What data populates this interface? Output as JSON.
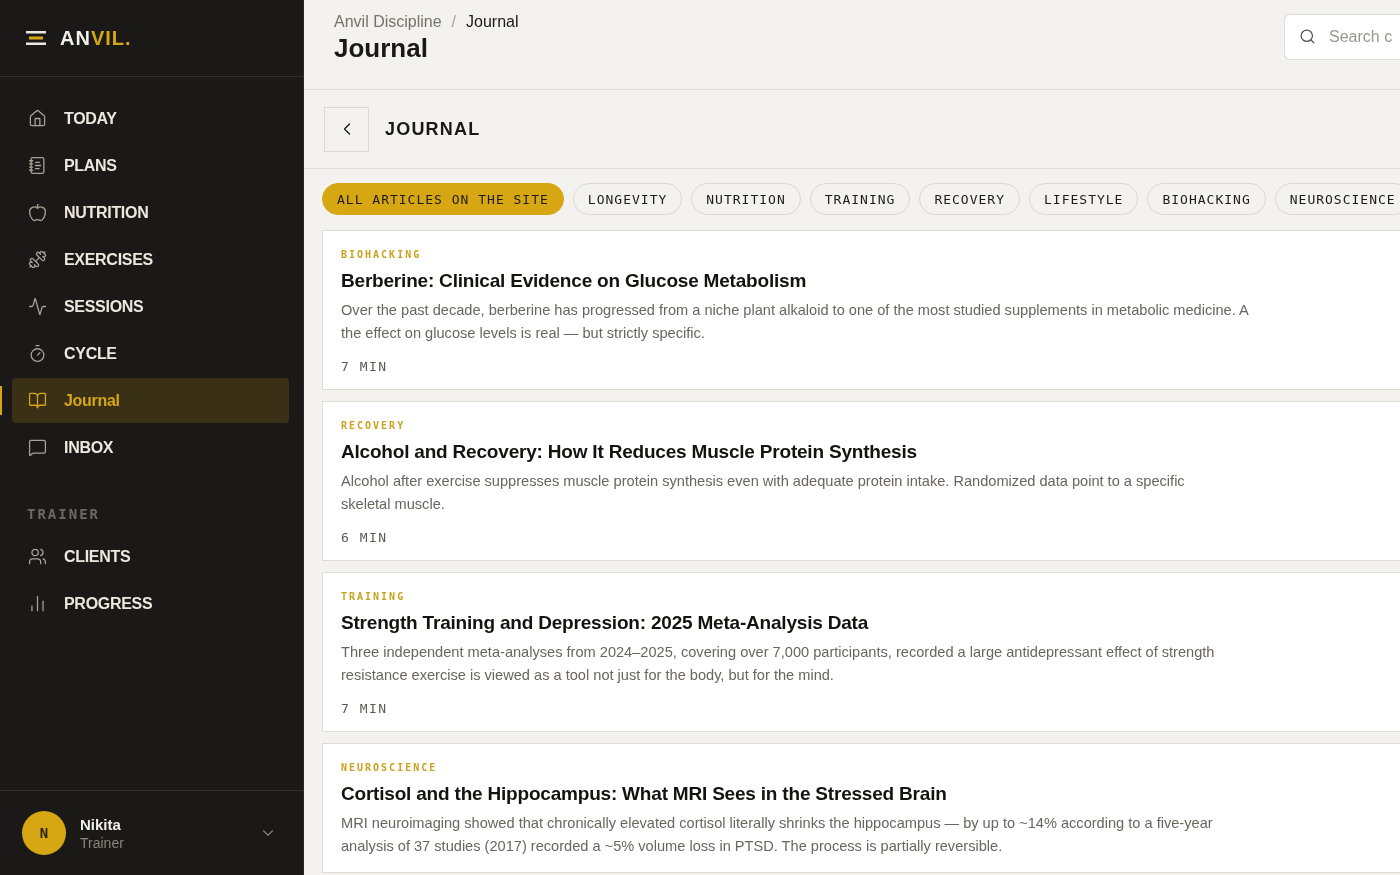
{
  "sidebar": {
    "logo": {
      "lead": "AN",
      "accent": "VIL."
    },
    "items": [
      {
        "label": "TODAY",
        "selected": false
      },
      {
        "label": "PLANS",
        "selected": false
      },
      {
        "label": "NUTRITION",
        "selected": false
      },
      {
        "label": "EXERCISES",
        "selected": false
      },
      {
        "label": "SESSIONS",
        "selected": false
      },
      {
        "label": "CYCLE",
        "selected": false
      },
      {
        "label": "Journal",
        "selected": true
      },
      {
        "label": "INBOX",
        "selected": false
      }
    ],
    "section_label": "TRAINER",
    "trainer_items": [
      {
        "label": "CLIENTS",
        "selected": false
      },
      {
        "label": "PROGRESS",
        "selected": false
      }
    ],
    "user": {
      "initial": "N",
      "name": "Nikita",
      "role": "Trainer"
    }
  },
  "header": {
    "breadcrumb": [
      "Anvil Discipline",
      "Journal"
    ],
    "separator": "/",
    "title": "Journal",
    "search": {
      "placeholder": "Search c"
    }
  },
  "subheader": {
    "title": "JOURNAL"
  },
  "filters": [
    {
      "label": "ALL ARTICLES ON THE SITE",
      "selected": true
    },
    {
      "label": "LONGEVITY",
      "selected": false
    },
    {
      "label": "NUTRITION",
      "selected": false
    },
    {
      "label": "TRAINING",
      "selected": false
    },
    {
      "label": "RECOVERY",
      "selected": false
    },
    {
      "label": "LIFESTYLE",
      "selected": false
    },
    {
      "label": "BIOHACKING",
      "selected": false
    },
    {
      "label": "NEUROSCIENCE",
      "selected": false
    }
  ],
  "articles": [
    {
      "tag": "BIOHACKING",
      "title": "Berberine: Clinical Evidence on Glucose Metabolism",
      "lines": [
        "Over the past decade, berberine has progressed from a niche plant alkaloid to one of the most studied supplements in metabolic medicine. A",
        "the effect on glucose levels is real — but strictly specific."
      ],
      "time": "7 MIN"
    },
    {
      "tag": "RECOVERY",
      "title": "Alcohol and Recovery: How It Reduces Muscle Protein Synthesis",
      "lines": [
        "Alcohol after exercise suppresses muscle protein synthesis even with adequate protein intake. Randomized data point to a specific",
        "skeletal muscle."
      ],
      "time": "6 MIN"
    },
    {
      "tag": "TRAINING",
      "title": "Strength Training and Depression: 2025 Meta-Analysis Data",
      "lines": [
        "Three independent meta-analyses from 2024–2025, covering over 7,000 participants, recorded a large antidepressant effect of strength",
        "resistance exercise is viewed as a tool not just for the body, but for the mind."
      ],
      "time": "7 MIN"
    },
    {
      "tag": "NEUROSCIENCE",
      "title": "Cortisol and the Hippocampus: What MRI Sees in the Stressed Brain",
      "lines": [
        "MRI neuroimaging showed that chronically elevated cortisol literally shrinks the hippocampus — by up to ~14% according to a five-year",
        "analysis of 37 studies (2017) recorded a ~5% volume loss in PTSD. The process is partially reversible."
      ]
    }
  ]
}
